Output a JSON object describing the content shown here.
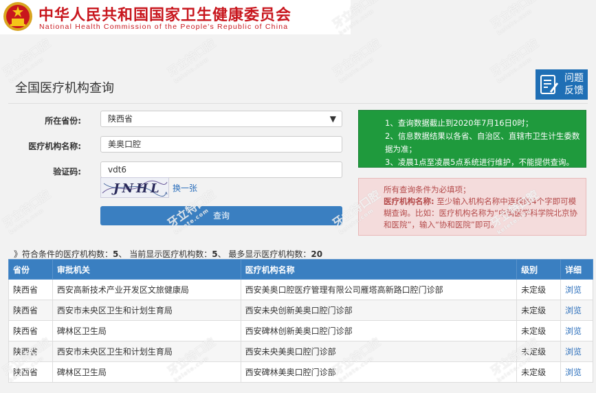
{
  "header": {
    "title_cn": "中华人民共和国国家卫生健康委员会",
    "title_en": "National Health Commission of the People's Republic of China"
  },
  "page": {
    "title": "全国医疗机构查询",
    "feedback_label_1": "问题",
    "feedback_label_2": "反馈"
  },
  "form": {
    "province_label": "所在省份:",
    "province_value": "陕西省",
    "org_name_label": "医疗机构名称:",
    "org_name_value": "美奥口腔",
    "captcha_label": "验证码:",
    "captcha_value": "vdt6",
    "captcha_image_text": "JNHL",
    "refresh_label": "换一张",
    "query_label": "查询"
  },
  "notices": {
    "green": [
      "1、查询数据截止到2020年7月16日0时；",
      "2、信息数据结果以各省、自治区、直辖市卫生计生委数据为准；",
      "3、凌晨1点至凌晨5点系统进行维护，不能提供查询。"
    ],
    "red_line1": "所有查询条件为必填项；",
    "red_label": "医疗机构名称:",
    "red_text": "至少输入机构名称中连续的4个字即可模糊查询。比如：医疗机构名称为“中国医学科学院北京协和医院”，输入“协和医院”即可。"
  },
  "summary": {
    "prefix": "》符合条件的医疗机构数：",
    "match_count": "5",
    "mid1": "、 当前显示医疗机构数：",
    "shown_count": "5",
    "mid2": "、 最多显示医疗机构数：",
    "max_count": "20"
  },
  "table": {
    "headers": [
      "省份",
      "审批机关",
      "医疗机构名称",
      "级别",
      "详细"
    ],
    "rows": [
      [
        "陕西省",
        "西安高新技术产业开发区文旅健康局",
        "西安美奥口腔医疗管理有限公司雁塔高新路口腔门诊部",
        "未定级",
        "浏览"
      ],
      [
        "陕西省",
        "西安市未央区卫生和计划生育局",
        "西安未央创新美奥口腔门诊部",
        "未定级",
        "浏览"
      ],
      [
        "陕西省",
        "碑林区卫生局",
        "西安碑林创新美奥口腔门诊部",
        "未定级",
        "浏览"
      ],
      [
        "陕西省",
        "西安市未央区卫生和计划生育局",
        "西安未央美奥口腔门诊部",
        "未定级",
        "浏览"
      ],
      [
        "陕西省",
        "碑林区卫生局",
        "西安碑林美奥口腔门诊部",
        "未定级",
        "浏览"
      ]
    ]
  },
  "watermark": {
    "text": "牙立特口腔",
    "sub": "kelete.com"
  },
  "colors": {
    "brand_red": "#c8161d",
    "primary_blue": "#3a7fc1",
    "notice_green": "#1f9a3d",
    "notice_red_bg": "#f4dcdc"
  }
}
